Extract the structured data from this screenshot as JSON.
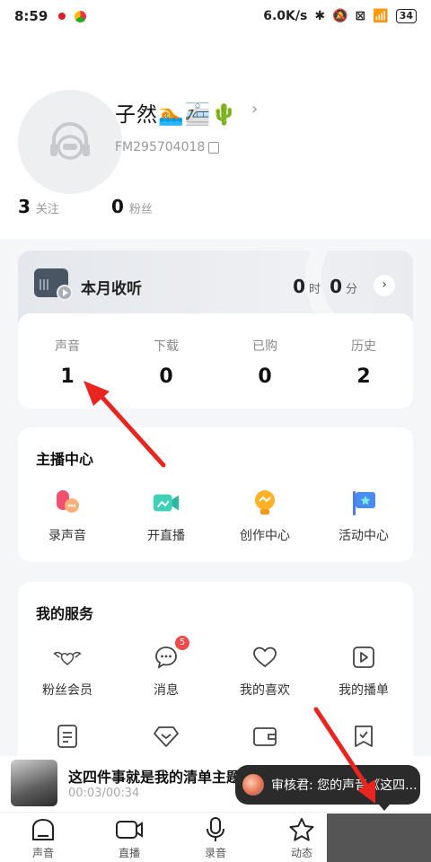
{
  "status_bar": {
    "time": "8:59",
    "network_speed": "6.0K/s",
    "battery": "34"
  },
  "profile": {
    "username": "子然🏊🚈🌵",
    "fm_id": "FM295704018",
    "stats": [
      {
        "value": "3",
        "label": "关注"
      },
      {
        "value": "0",
        "label": "粉丝"
      }
    ]
  },
  "listening": {
    "title": "本月收听",
    "hours": "0",
    "hours_unit": "时",
    "minutes": "0",
    "minutes_unit": "分"
  },
  "counts": [
    {
      "label": "声音",
      "value": "1"
    },
    {
      "label": "下载",
      "value": "0"
    },
    {
      "label": "已购",
      "value": "0"
    },
    {
      "label": "历史",
      "value": "2"
    }
  ],
  "anchor_center": {
    "title": "主播中心",
    "items": [
      {
        "label": "录声音",
        "icon": "record-voice-icon"
      },
      {
        "label": "开直播",
        "icon": "live-camera-icon"
      },
      {
        "label": "创作中心",
        "icon": "bulb-icon"
      },
      {
        "label": "活动中心",
        "icon": "activity-flag-icon"
      }
    ]
  },
  "services": {
    "title": "我的服务",
    "items": [
      {
        "label": "粉丝会员",
        "icon": "wings-heart-icon"
      },
      {
        "label": "消息",
        "icon": "chat-bubble-icon",
        "badge": "5"
      },
      {
        "label": "我的喜欢",
        "icon": "heart-icon"
      },
      {
        "label": "我的播单",
        "icon": "playlist-icon"
      }
    ],
    "row2_icons": [
      "document-icon",
      "diamond-icon",
      "wallet-icon",
      "bookmark-check-icon"
    ]
  },
  "player": {
    "title": "这四件事就是我的清单主题",
    "time": "00:03/00:34"
  },
  "toast": {
    "text": "审核君: 您的声音《这四..."
  },
  "tabbar": [
    {
      "label": "声音",
      "icon": "home-icon"
    },
    {
      "label": "直播",
      "icon": "video-icon"
    },
    {
      "label": "录音",
      "icon": "mic-icon"
    },
    {
      "label": "动态",
      "icon": "star-icon"
    }
  ],
  "colors": {
    "annotation_arrow": "#e8251f",
    "badge": "#f04a4a",
    "toast_bg": "#2b2b2b"
  }
}
